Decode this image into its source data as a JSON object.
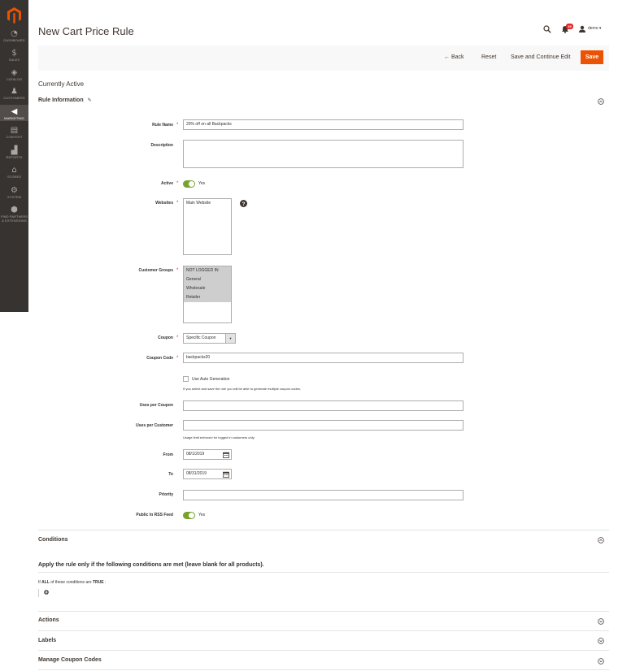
{
  "sidebar": {
    "items": [
      {
        "label": "DASHBOARD",
        "icon": "dashboard-icon"
      },
      {
        "label": "SALES",
        "icon": "dollar-icon"
      },
      {
        "label": "CATALOG",
        "icon": "cube-icon"
      },
      {
        "label": "CUSTOMERS",
        "icon": "person-icon"
      },
      {
        "label": "MARKETING",
        "icon": "megaphone-icon"
      },
      {
        "label": "CONTENT",
        "icon": "content-icon"
      },
      {
        "label": "REPORTS",
        "icon": "bar-chart-icon"
      },
      {
        "label": "STORES",
        "icon": "store-icon"
      },
      {
        "label": "SYSTEM",
        "icon": "gear-icon"
      },
      {
        "label": "FIND PARTNERS",
        "label2": "& EXTENSIONS",
        "icon": "extensions-icon"
      }
    ],
    "accent": "#eb5202"
  },
  "header": {
    "title": "New Cart Price Rule",
    "notifications": "39",
    "user": "demo ▾"
  },
  "toolbar": {
    "back": "Back",
    "reset": "Reset",
    "save_continue": "Save and Continue Edit",
    "save": "Save"
  },
  "status": "Currently Active",
  "rule_info": {
    "title": "Rule Information",
    "rule_name_label": "Rule Name",
    "rule_name": "20% off on all Backpacks",
    "description_label": "Description",
    "active_label": "Active",
    "active_value": "Yes",
    "websites_label": "Websites",
    "websites": [
      "Main Website"
    ],
    "customer_groups_label": "Customer Groups",
    "customer_groups": [
      "NOT LOGGED IN",
      "General",
      "Wholesale",
      "Retailer"
    ],
    "coupon_label": "Coupon",
    "coupon_value": "Specific Coupon",
    "coupon_code_label": "Coupon Code",
    "coupon_code": "backpacks20",
    "auto_gen_label": "Use Auto Generation",
    "auto_gen_note": "If you select and save the rule you will be able to generate multiple coupon codes.",
    "uses_per_coupon_label": "Uses per Coupon",
    "uses_per_customer_label": "Uses per Customer",
    "uses_per_customer_note": "Usage limit enforced for logged in customers only.",
    "from_label": "From",
    "from_value": "08/1/2019",
    "to_label": "To",
    "to_value": "08/31/2019",
    "priority_label": "Priority",
    "rss_label": "Public In RSS Feed",
    "rss_value": "Yes"
  },
  "conditions": {
    "title": "Conditions",
    "text": "Apply the rule only if the following conditions are met (leave blank for all products).",
    "rule_if": "If",
    "rule_all": "ALL",
    "rule_mid": "of these conditions are",
    "rule_true": "TRUE",
    "rule_end": ":"
  },
  "sections": {
    "actions": "Actions",
    "labels": "Labels",
    "manage_coupons": "Manage Coupon Codes"
  }
}
